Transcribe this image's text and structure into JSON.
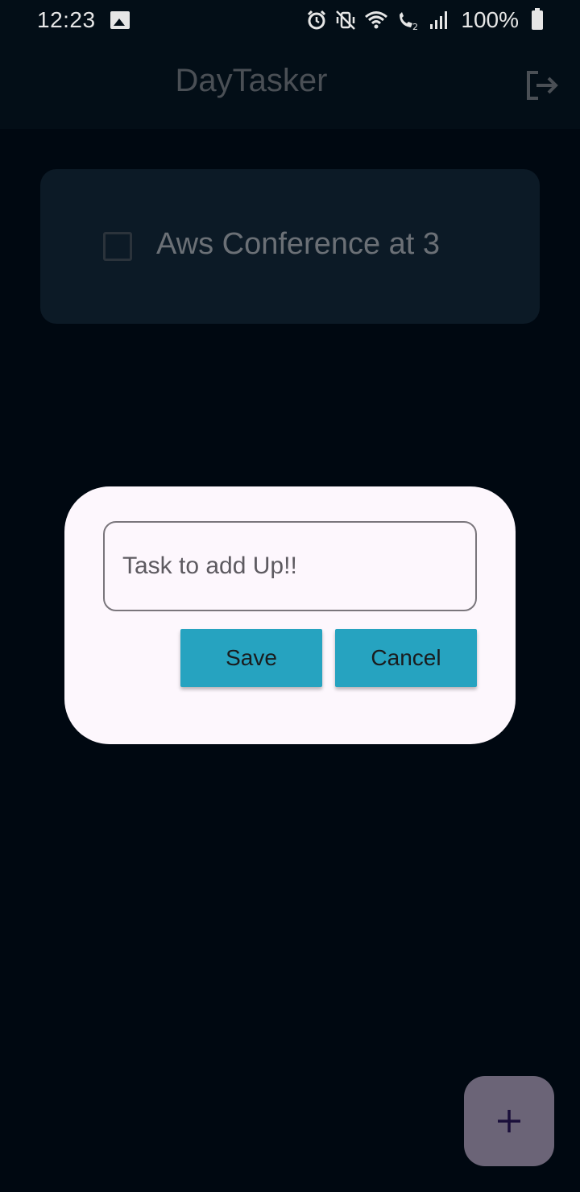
{
  "status_bar": {
    "time": "12:23",
    "battery": "100%",
    "icons": [
      "gallery-icon",
      "alarm-icon",
      "vibrate-off-icon",
      "wifi-icon",
      "wifi-calling-icon",
      "signal-icon",
      "battery-icon"
    ]
  },
  "app_bar": {
    "title": "DayTasker",
    "action_icon": "logout-icon"
  },
  "tasks": [
    {
      "label": "Aws Conference at 3",
      "checked": false
    }
  ],
  "dialog": {
    "input_placeholder": "Task to add Up!!",
    "input_value": "",
    "save_label": "Save",
    "cancel_label": "Cancel"
  },
  "fab": {
    "icon": "plus-icon"
  },
  "colors": {
    "background": "#000811",
    "app_bar": "#030e17",
    "card": "#0c1a26",
    "dialog": "#fdf7fd",
    "button": "#26a3c0",
    "fab": "#6b6477"
  }
}
